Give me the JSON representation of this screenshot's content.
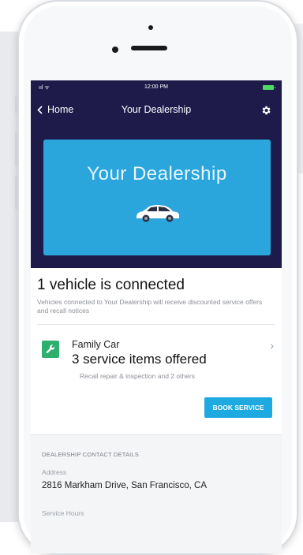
{
  "status_bar": {
    "signal": "ııl ᯤ",
    "time": "12:00 PM"
  },
  "nav": {
    "back_label": "Home",
    "title": "Your Dealership"
  },
  "banner": {
    "title": "Your Dealership"
  },
  "connected": {
    "title": "1 vehicle is connected",
    "subtitle": "Vehicles connected to Your Dealership will receive discounted service offers and recall notices"
  },
  "vehicle": {
    "name": "Family Car",
    "items_offered": "3 service items offered",
    "description": "Recall repair & inspection and 2 others"
  },
  "book_service_label": "BOOK SERVICE",
  "contact": {
    "heading": "DEALERSHIP CONTACT DETAILS",
    "address_label": "Address",
    "address_value": "2816 Markham Drive, San Francisco, CA",
    "hours_label": "Service Hours"
  },
  "colors": {
    "header": "#1e1b4b",
    "banner": "#2aa6dd",
    "button": "#1ea9e0",
    "wrench": "#2eaf6e"
  }
}
